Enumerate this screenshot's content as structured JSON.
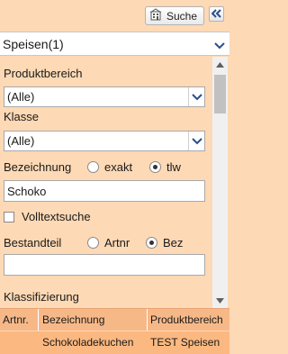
{
  "topbar": {
    "search_label": "Suche",
    "search_icon": "building-icon",
    "collapse_icon": "double-chevron-left-icon"
  },
  "main_select": {
    "value": "Speisen(1)"
  },
  "filters": {
    "produktbereich": {
      "label": "Produktbereich",
      "value": "(Alle)"
    },
    "klasse": {
      "label": "Klasse",
      "value": "(Alle)"
    },
    "bezeichnung": {
      "label": "Bezeichnung",
      "options": [
        {
          "label": "exakt",
          "checked": false
        },
        {
          "label": "tlw",
          "checked": true
        }
      ],
      "value": "Schoko"
    },
    "volltextsuche": {
      "label": "Volltextsuche",
      "checked": false
    },
    "bestandteil": {
      "label": "Bestandteil",
      "options": [
        {
          "label": "Artnr",
          "checked": false
        },
        {
          "label": "Bez",
          "checked": true
        }
      ],
      "value": ""
    },
    "klassifizierung": {
      "label": "Klassifizierung"
    }
  },
  "table": {
    "columns": [
      "Artnr.",
      "Bezeichnung",
      "Produktbereich"
    ],
    "rows": [
      [
        "",
        "Schokoladekuchen",
        "TEST Speisen"
      ]
    ]
  },
  "colors": {
    "panel_bg": "#fdd9b5",
    "table_header_bg": "#f7b888",
    "table_row_bg": "#fbb880",
    "caret_blue": "#2a4d8a"
  }
}
